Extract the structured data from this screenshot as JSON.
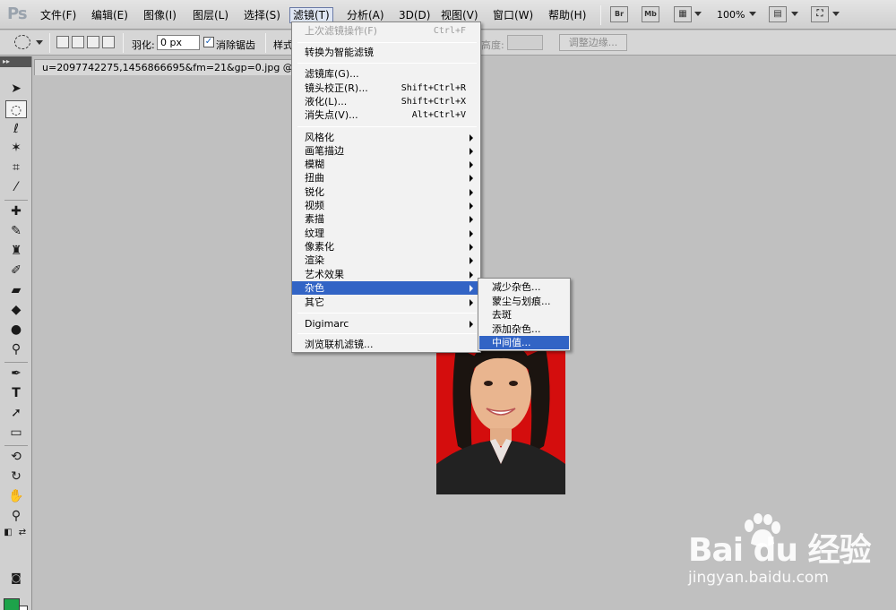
{
  "app": {
    "logo": "Ps"
  },
  "menubar": {
    "items": [
      "文件(F)",
      "编辑(E)",
      "图像(I)",
      "图层(L)",
      "选择(S)",
      "滤镜(T)",
      "分析(A)",
      "3D(D)",
      "视图(V)",
      "窗口(W)",
      "帮助(H)"
    ],
    "active": "滤镜(T)",
    "bridge_btn": "Br",
    "minibridge_btn": "Mb",
    "zoom": "100%"
  },
  "options": {
    "feather_label": "羽化:",
    "feather_value": "0 px",
    "antialias_label": "消除锯齿",
    "antialias_checked": "✓",
    "style_label": "样式",
    "height_label": "高度:",
    "refine_edge": "调整边缘..."
  },
  "document": {
    "tab_title": "u=2097742275,1456866695&fm=21&gp=0.jpg @ 1"
  },
  "filter_menu": {
    "last_filter": {
      "label": "上次滤镜操作(F)",
      "shortcut": "Ctrl+F"
    },
    "smart_filter": "转换为智能滤镜",
    "top_items": [
      {
        "label": "滤镜库(G)...",
        "shortcut": ""
      },
      {
        "label": "镜头校正(R)...",
        "shortcut": "Shift+Ctrl+R"
      },
      {
        "label": "液化(L)...",
        "shortcut": "Shift+Ctrl+X"
      },
      {
        "label": "消失点(V)...",
        "shortcut": "Alt+Ctrl+V"
      }
    ],
    "groups": [
      "风格化",
      "画笔描边",
      "模糊",
      "扭曲",
      "锐化",
      "视频",
      "素描",
      "纹理",
      "像素化",
      "渲染",
      "艺术效果",
      "杂色",
      "其它"
    ],
    "highlighted_group": "杂色",
    "digimarc": "Digimarc",
    "browse_online": "浏览联机滤镜..."
  },
  "noise_submenu": {
    "items": [
      "减少杂色...",
      "蒙尘与划痕...",
      "去斑",
      "添加杂色...",
      "中间值..."
    ],
    "highlighted": "中间值..."
  },
  "colors": {
    "foreground": "#1da34a",
    "background": "#ffffff",
    "highlight": "#3264c5"
  },
  "watermark": {
    "main": "Bai du 经验",
    "sub": "jingyan.baidu.com"
  }
}
